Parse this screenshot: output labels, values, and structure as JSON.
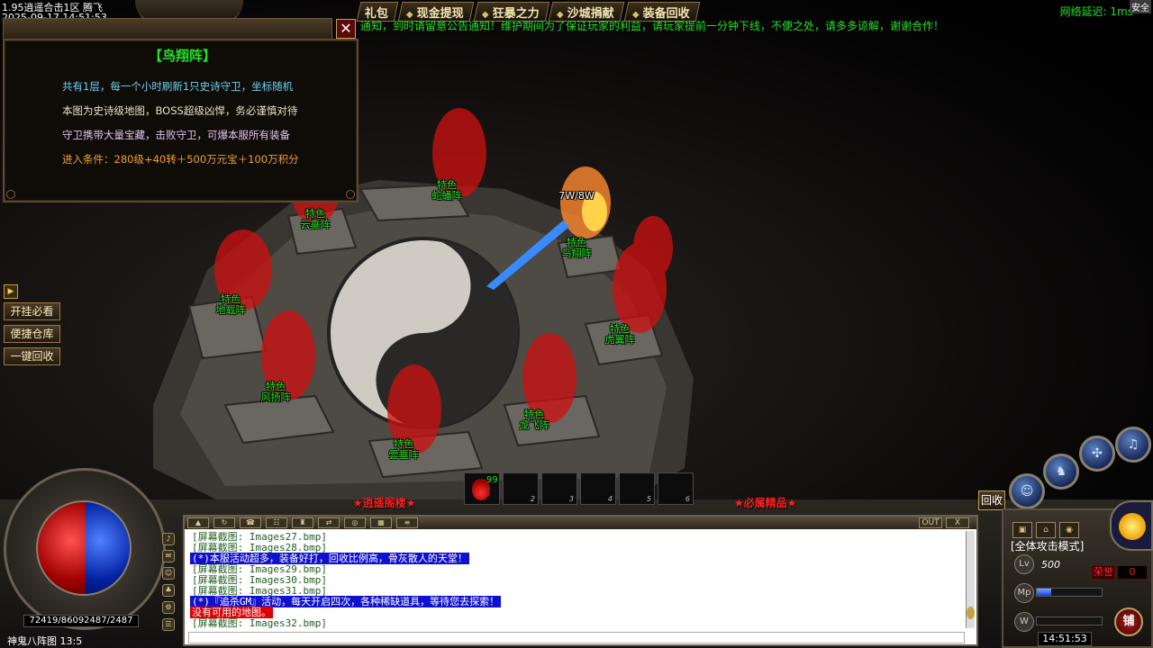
{
  "header": {
    "server_line": "1.95逍遥合击1区 腾飞",
    "date_line": "2025-09-17 14:51:53",
    "menu": [
      "礼包",
      "现金提现",
      "狂暴之力",
      "沙城捐献",
      "装备回收"
    ],
    "notice": "通知，到时请留意公告通知！维护期间为了保证玩家的利益，请玩家提前一分钟下线，不便之处，请多多谅解，谢谢合作！",
    "latency": "网络延迟: 1ms",
    "safe": "安全"
  },
  "info_panel": {
    "title": "【鸟翔阵】",
    "line1": "共有1层，每一个小时刷新1只史诗守卫，坐标随机",
    "line2": "本图为史诗级地图，BOSS超级凶悍，务必谨慎对待",
    "line3": "守卫携带大量宝藏，击败守卫，可爆本服所有装备",
    "line4": "进入条件：280级+40转＋500万元宝＋100万积分",
    "close": "✕"
  },
  "side_buttons": [
    "开挂必看",
    "便捷仓库",
    "一键回收"
  ],
  "side_toggle": "▶",
  "map_labels": [
    {
      "top": "特色",
      "bottom": "蛇蟠阵"
    },
    {
      "top": "特色",
      "bottom": "云垂阵"
    },
    {
      "top": "特色",
      "bottom": "鸟翔阵"
    },
    {
      "top": "特色",
      "bottom": "地载阵"
    },
    {
      "top": "特色",
      "bottom": "虎翼阵"
    },
    {
      "top": "特色",
      "bottom": "风扬阵"
    },
    {
      "top": "特色",
      "bottom": "龙飞阵"
    },
    {
      "top": "特色",
      "bottom": "雲垂阵"
    }
  ],
  "player_name": "7W/8W",
  "hud": {
    "hp_mp": "72419/86092487/2487",
    "location": "神鬼八阵图 13:5",
    "potion_count": "99",
    "belt_slots": [
      "2",
      "3",
      "4",
      "5",
      "6"
    ],
    "left_red": "★逍遥阁楼★",
    "right_red": "★必属精品★",
    "recycle": "回收",
    "attack_mode": "[全体攻击模式]",
    "level": "500",
    "honor_label": "荣誉",
    "honor_value": "0",
    "clock": "14:51:53",
    "shop": "铺",
    "mp_fill": 0.22
  },
  "chat": {
    "out": "OUT",
    "close": "X",
    "lines": [
      {
        "type": "shot",
        "text": "[屏幕截图: Images27.bmp]"
      },
      {
        "type": "shot",
        "text": "[屏幕截图: Images28.bmp]"
      },
      {
        "type": "blue",
        "text": "(*)本服活动超多，装备好打，回收比例高，骨灰散人的天堂！"
      },
      {
        "type": "shot",
        "text": "[屏幕截图: Images29.bmp]"
      },
      {
        "type": "shot",
        "text": "[屏幕截图: Images30.bmp]"
      },
      {
        "type": "shot",
        "text": "[屏幕截图: Images31.bmp]"
      },
      {
        "type": "blue",
        "text": "(*)『追杀GM』活动，每天开启四次，各种稀缺道具，等待您去探索！"
      },
      {
        "type": "red",
        "text": "没有可用的地图。"
      },
      {
        "type": "shot",
        "text": "[屏幕截图: Images32.bmp]"
      }
    ]
  },
  "colors": {
    "label_green": "#23e623",
    "gold": "#f2e6b0",
    "notice_green": "#28e028"
  }
}
